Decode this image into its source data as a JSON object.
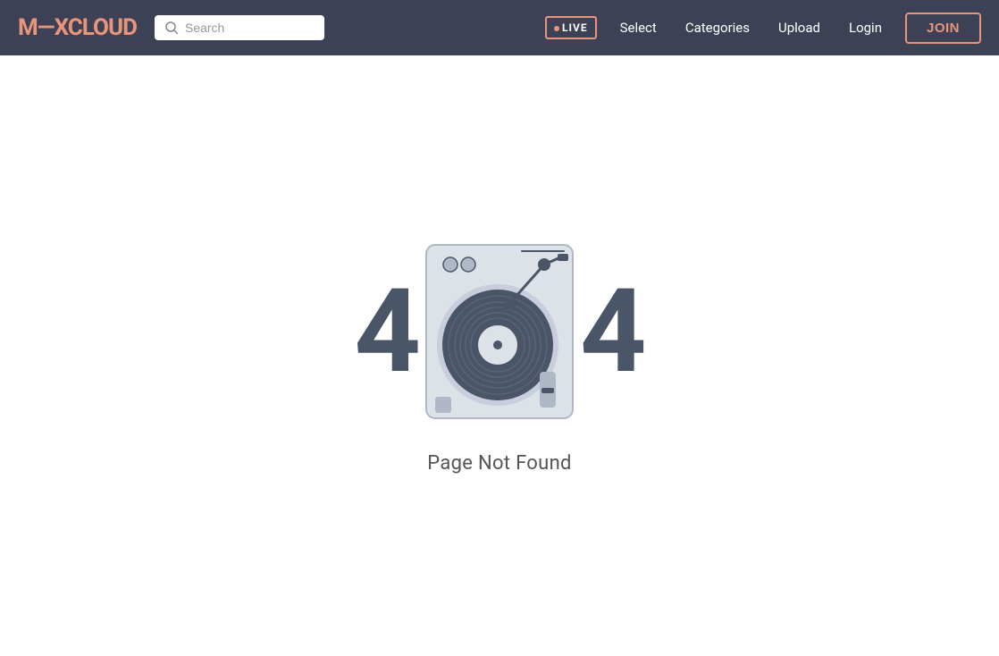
{
  "navbar": {
    "logo_text": "M—XCLOUD",
    "search_placeholder": "Search",
    "live_label": "LIVE",
    "select_label": "Select",
    "categories_label": "Categories",
    "upload_label": "Upload",
    "login_label": "Login",
    "join_label": "JOIN"
  },
  "main": {
    "error_left": "4",
    "error_right": "4",
    "page_not_found": "Page Not Found"
  },
  "colors": {
    "navbar_bg": "#3d4155",
    "brand_accent": "#e8957a",
    "turntable_body": "#dde1e8",
    "turntable_dark": "#4a5568"
  }
}
